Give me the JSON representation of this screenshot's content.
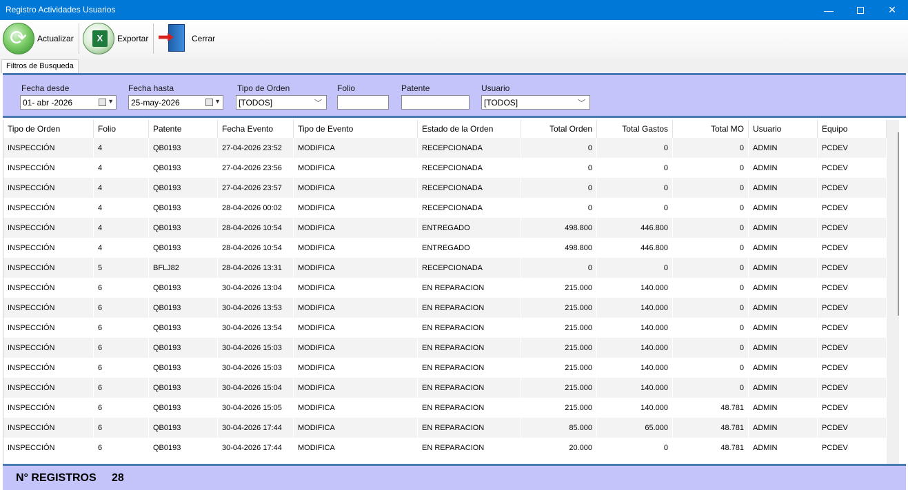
{
  "window": {
    "title": "Registro Actividades Usuarios"
  },
  "toolbar": {
    "refresh": "Actualizar",
    "export": "Exportar",
    "close": "Cerrar"
  },
  "tab": "Filtros de Busqueda",
  "filters": {
    "fecha_desde": {
      "label": "Fecha desde",
      "value": "01- abr -2026"
    },
    "fecha_hasta": {
      "label": "Fecha hasta",
      "value": "25-may-2026"
    },
    "tipo_orden": {
      "label": "Tipo de Orden",
      "value": "[TODOS]"
    },
    "folio": {
      "label": "Folio",
      "value": ""
    },
    "patente": {
      "label": "Patente",
      "value": ""
    },
    "usuario": {
      "label": "Usuario",
      "value": "[TODOS]"
    }
  },
  "columns": [
    "Tipo de Orden",
    "Folio",
    "Patente",
    "Fecha Evento",
    "Tipo de Evento",
    "Estado de la Orden",
    "Total Orden",
    "Total Gastos",
    "Total MO",
    "Usuario",
    "Equipo"
  ],
  "rows": [
    [
      "INSPECCIÓN",
      "4",
      "QB0193",
      "27-04-2026 23:52",
      "MODIFICA",
      "RECEPCIONADA",
      "0",
      "0",
      "0",
      "ADMIN",
      "PCDEV"
    ],
    [
      "INSPECCIÓN",
      "4",
      "QB0193",
      "27-04-2026 23:56",
      "MODIFICA",
      "RECEPCIONADA",
      "0",
      "0",
      "0",
      "ADMIN",
      "PCDEV"
    ],
    [
      "INSPECCIÓN",
      "4",
      "QB0193",
      "27-04-2026 23:57",
      "MODIFICA",
      "RECEPCIONADA",
      "0",
      "0",
      "0",
      "ADMIN",
      "PCDEV"
    ],
    [
      "INSPECCIÓN",
      "4",
      "QB0193",
      "28-04-2026 00:02",
      "MODIFICA",
      "RECEPCIONADA",
      "0",
      "0",
      "0",
      "ADMIN",
      "PCDEV"
    ],
    [
      "INSPECCIÓN",
      "4",
      "QB0193",
      "28-04-2026 10:54",
      "MODIFICA",
      "ENTREGADO",
      "498.800",
      "446.800",
      "0",
      "ADMIN",
      "PCDEV"
    ],
    [
      "INSPECCIÓN",
      "4",
      "QB0193",
      "28-04-2026 10:54",
      "MODIFICA",
      "ENTREGADO",
      "498.800",
      "446.800",
      "0",
      "ADMIN",
      "PCDEV"
    ],
    [
      "INSPECCIÓN",
      "5",
      "BFLJ82",
      "28-04-2026 13:31",
      "MODIFICA",
      "RECEPCIONADA",
      "0",
      "0",
      "0",
      "ADMIN",
      "PCDEV"
    ],
    [
      "INSPECCIÓN",
      "6",
      "QB0193",
      "30-04-2026 13:04",
      "MODIFICA",
      "EN REPARACION",
      "215.000",
      "140.000",
      "0",
      "ADMIN",
      "PCDEV"
    ],
    [
      "INSPECCIÓN",
      "6",
      "QB0193",
      "30-04-2026 13:53",
      "MODIFICA",
      "EN REPARACION",
      "215.000",
      "140.000",
      "0",
      "ADMIN",
      "PCDEV"
    ],
    [
      "INSPECCIÓN",
      "6",
      "QB0193",
      "30-04-2026 13:54",
      "MODIFICA",
      "EN REPARACION",
      "215.000",
      "140.000",
      "0",
      "ADMIN",
      "PCDEV"
    ],
    [
      "INSPECCIÓN",
      "6",
      "QB0193",
      "30-04-2026 15:03",
      "MODIFICA",
      "EN REPARACION",
      "215.000",
      "140.000",
      "0",
      "ADMIN",
      "PCDEV"
    ],
    [
      "INSPECCIÓN",
      "6",
      "QB0193",
      "30-04-2026 15:03",
      "MODIFICA",
      "EN REPARACION",
      "215.000",
      "140.000",
      "0",
      "ADMIN",
      "PCDEV"
    ],
    [
      "INSPECCIÓN",
      "6",
      "QB0193",
      "30-04-2026 15:04",
      "MODIFICA",
      "EN REPARACION",
      "215.000",
      "140.000",
      "0",
      "ADMIN",
      "PCDEV"
    ],
    [
      "INSPECCIÓN",
      "6",
      "QB0193",
      "30-04-2026 15:05",
      "MODIFICA",
      "EN REPARACION",
      "215.000",
      "140.000",
      "48.781",
      "ADMIN",
      "PCDEV"
    ],
    [
      "INSPECCIÓN",
      "6",
      "QB0193",
      "30-04-2026 17:44",
      "MODIFICA",
      "EN REPARACION",
      "85.000",
      "65.000",
      "48.781",
      "ADMIN",
      "PCDEV"
    ],
    [
      "INSPECCIÓN",
      "6",
      "QB0193",
      "30-04-2026 17:44",
      "MODIFICA",
      "EN REPARACION",
      "20.000",
      "0",
      "48.781",
      "ADMIN",
      "PCDEV"
    ]
  ],
  "footer": {
    "label": "N° REGISTROS",
    "count": "28"
  },
  "colors": {
    "titlebar": "#0078d7",
    "panel": "#c4c4fa",
    "panel_border": "#4a7ab2"
  }
}
